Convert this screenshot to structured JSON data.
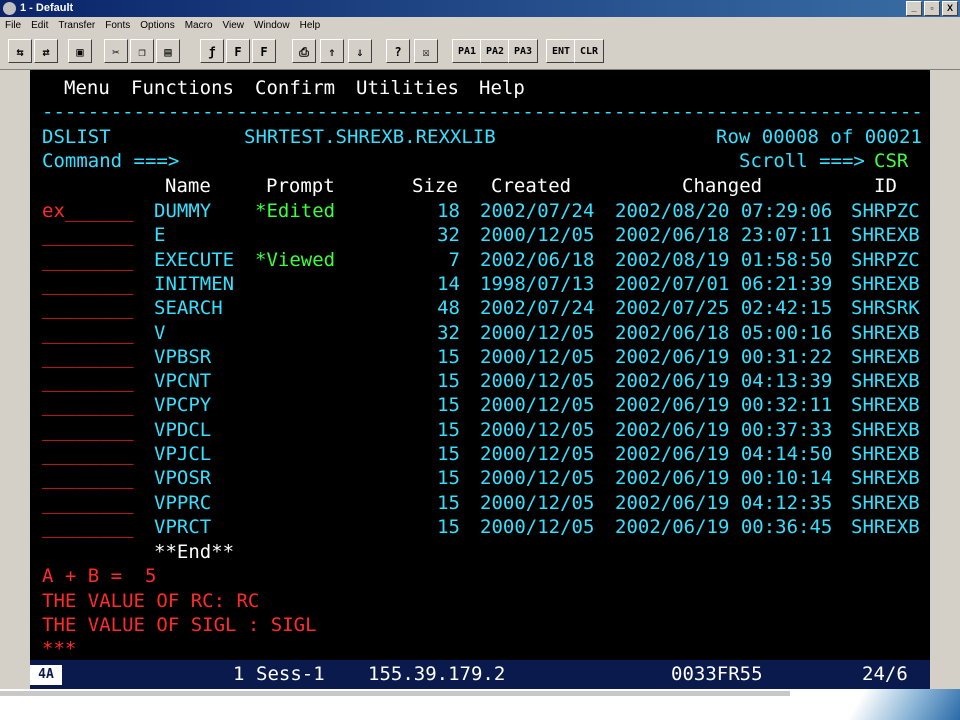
{
  "window": {
    "title": "1 - Default",
    "buttons": [
      "_",
      "▫",
      "X"
    ]
  },
  "menubar": [
    "File",
    "Edit",
    "Transfer",
    "Fonts",
    "Options",
    "Macro",
    "View",
    "Window",
    "Help"
  ],
  "toolbar": {
    "pa1": "PA1",
    "pa2": "PA2",
    "pa3": "PA3",
    "ent": "ENT",
    "clr": "CLR"
  },
  "panel": {
    "menu": [
      "Menu",
      "Functions",
      "Confirm",
      "Utilities",
      "Help"
    ],
    "separator": "-----------------------------------------------------------------------------",
    "title": "DSLIST",
    "dataset": "SHRTEST.SHREXB.REXXLIB",
    "row_info": "Row 00008 of 00021",
    "command_label": "Command ===>",
    "scroll_label": "Scroll ===>",
    "scroll_value": "CSR",
    "headers": {
      "name": "Name",
      "prompt": "Prompt",
      "size": "Size",
      "created": "Created",
      "changed": "Changed",
      "id": "ID"
    },
    "members": [
      {
        "cmd": "ex______",
        "name": "DUMMY",
        "prompt": "*Edited",
        "size": "18",
        "created": "2002/07/24",
        "changed": "2002/08/20 07:29:06",
        "id": "SHRPZC"
      },
      {
        "cmd": "________",
        "name": "E",
        "prompt": "",
        "size": "32",
        "created": "2000/12/05",
        "changed": "2002/06/18 23:07:11",
        "id": "SHREXB"
      },
      {
        "cmd": "________",
        "name": "EXECUTE",
        "prompt": "*Viewed",
        "size": "7",
        "created": "2002/06/18",
        "changed": "2002/08/19 01:58:50",
        "id": "SHRPZC"
      },
      {
        "cmd": "________",
        "name": "INITMEN",
        "prompt": "",
        "size": "14",
        "created": "1998/07/13",
        "changed": "2002/07/01 06:21:39",
        "id": "SHREXB"
      },
      {
        "cmd": "________",
        "name": "SEARCH",
        "prompt": "",
        "size": "48",
        "created": "2002/07/24",
        "changed": "2002/07/25 02:42:15",
        "id": "SHRSRK"
      },
      {
        "cmd": "________",
        "name": "V",
        "prompt": "",
        "size": "32",
        "created": "2000/12/05",
        "changed": "2002/06/18 05:00:16",
        "id": "SHREXB"
      },
      {
        "cmd": "________",
        "name": "VPBSR",
        "prompt": "",
        "size": "15",
        "created": "2000/12/05",
        "changed": "2002/06/19 00:31:22",
        "id": "SHREXB"
      },
      {
        "cmd": "________",
        "name": "VPCNT",
        "prompt": "",
        "size": "15",
        "created": "2000/12/05",
        "changed": "2002/06/19 04:13:39",
        "id": "SHREXB"
      },
      {
        "cmd": "________",
        "name": "VPCPY",
        "prompt": "",
        "size": "15",
        "created": "2000/12/05",
        "changed": "2002/06/19 00:32:11",
        "id": "SHREXB"
      },
      {
        "cmd": "________",
        "name": "VPDCL",
        "prompt": "",
        "size": "15",
        "created": "2000/12/05",
        "changed": "2002/06/19 00:37:33",
        "id": "SHREXB"
      },
      {
        "cmd": "________",
        "name": "VPJCL",
        "prompt": "",
        "size": "15",
        "created": "2000/12/05",
        "changed": "2002/06/19 04:14:50",
        "id": "SHREXB"
      },
      {
        "cmd": "________",
        "name": "VPOSR",
        "prompt": "",
        "size": "15",
        "created": "2000/12/05",
        "changed": "2002/06/19 00:10:14",
        "id": "SHREXB"
      },
      {
        "cmd": "________",
        "name": "VPPRC",
        "prompt": "",
        "size": "15",
        "created": "2000/12/05",
        "changed": "2002/06/19 04:12:35",
        "id": "SHREXB"
      },
      {
        "cmd": "________",
        "name": "VPRCT",
        "prompt": "",
        "size": "15",
        "created": "2000/12/05",
        "changed": "2002/06/19 00:36:45",
        "id": "SHREXB"
      }
    ],
    "end_marker": "**End**",
    "output": [
      "A + B =  5",
      "THE VALUE OF RC: RC",
      "THE VALUE OF SIGL : SIGL",
      "***"
    ]
  },
  "status": {
    "badge": "4A",
    "session_number": "1",
    "session_name": "Sess-1",
    "ip": "155.39.179.2",
    "lu": "0033FR55",
    "cursor": "24/6"
  },
  "colors": {
    "terminal_bg": "#000000",
    "cyan": "#35e0ff",
    "green": "#3dff3d",
    "red": "#ff2a2a",
    "white": "#ffffff",
    "status_bg": "#0a1a4d"
  }
}
